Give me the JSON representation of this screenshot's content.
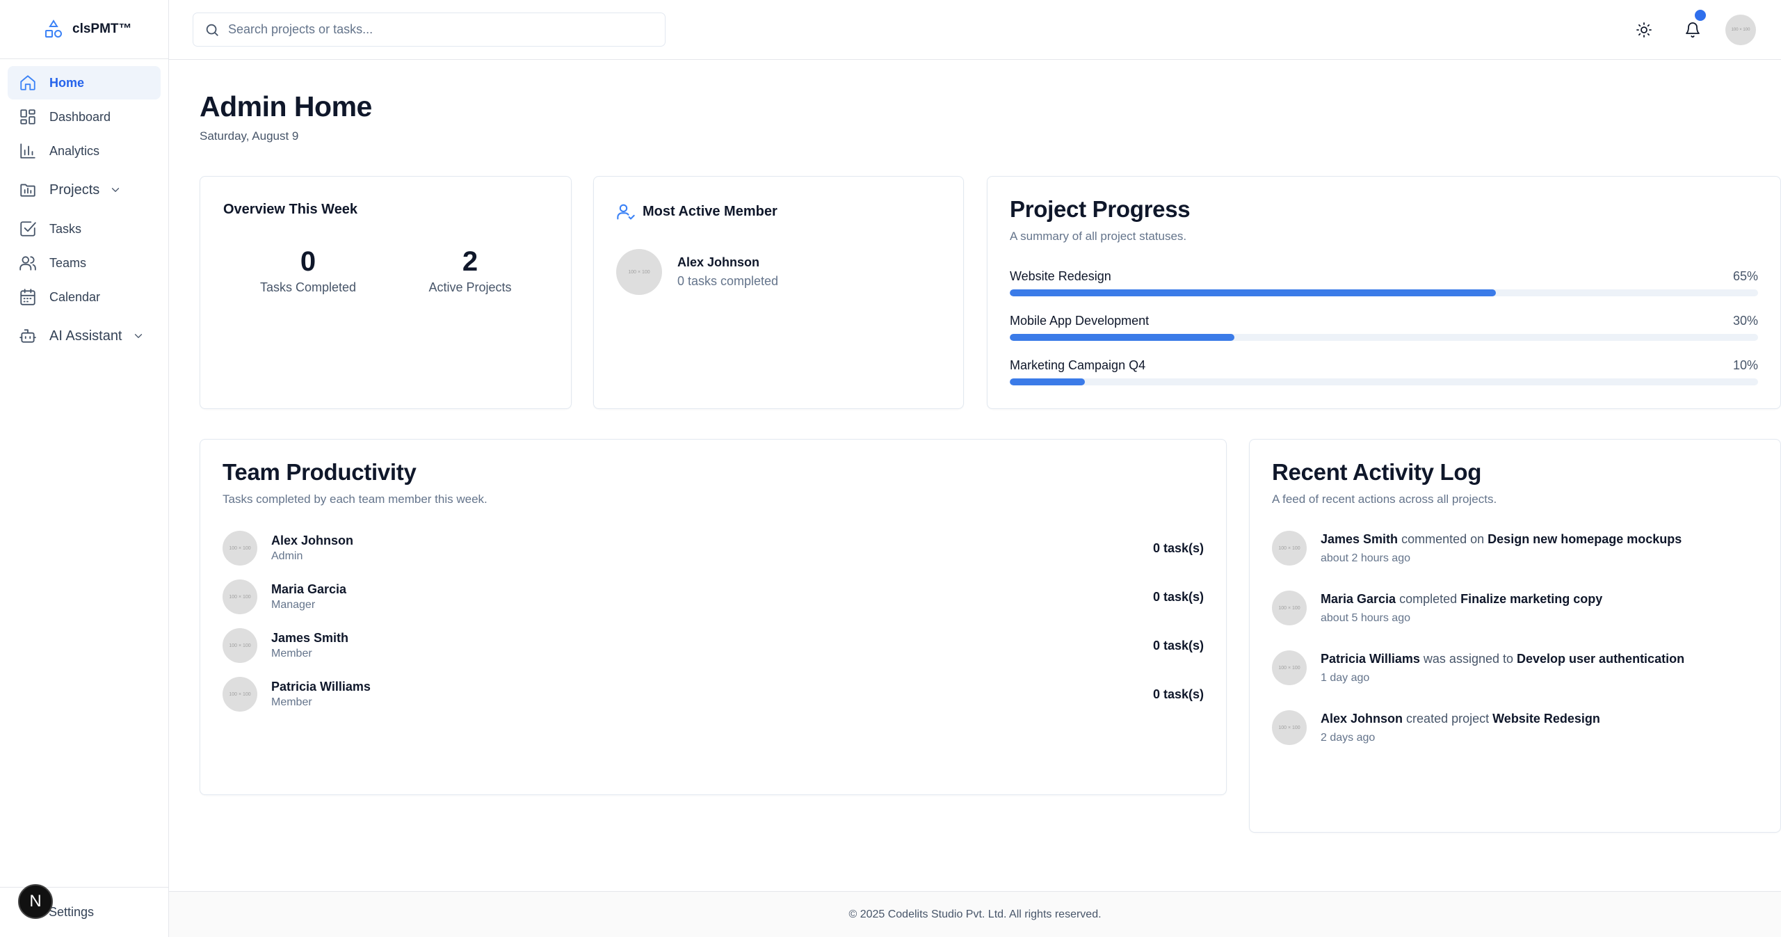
{
  "brand": {
    "name": "clsPMT™"
  },
  "sidebar": {
    "items": [
      {
        "label": "Home"
      },
      {
        "label": "Dashboard"
      },
      {
        "label": "Analytics"
      },
      {
        "label": "Projects"
      },
      {
        "label": "Tasks"
      },
      {
        "label": "Teams"
      },
      {
        "label": "Calendar"
      },
      {
        "label": "AI Assistant"
      }
    ],
    "settings_label": "Settings",
    "n_badge": "N"
  },
  "topbar": {
    "search_placeholder": "Search projects or tasks...",
    "avatar_text": "100 × 100"
  },
  "page": {
    "title": "Admin Home",
    "date": "Saturday, August 9"
  },
  "overview": {
    "title": "Overview This Week",
    "tasks_completed": "0",
    "tasks_completed_label": "Tasks Completed",
    "active_projects": "2",
    "active_projects_label": "Active Projects"
  },
  "most_active": {
    "title": "Most Active Member",
    "name": "Alex Johnson",
    "detail": "0 tasks completed",
    "avatar_text": "100 × 100"
  },
  "project_progress": {
    "title": "Project Progress",
    "subtitle": "A summary of all project statuses.",
    "projects": [
      {
        "name": "Website Redesign",
        "percent_label": "65%",
        "percent": 65
      },
      {
        "name": "Mobile App Development",
        "percent_label": "30%",
        "percent": 30
      },
      {
        "name": "Marketing Campaign Q4",
        "percent_label": "10%",
        "percent": 10
      }
    ]
  },
  "team_productivity": {
    "title": "Team Productivity",
    "subtitle": "Tasks completed by each team member this week.",
    "members": [
      {
        "name": "Alex Johnson",
        "role": "Admin",
        "count": "0 task(s)",
        "avatar_text": "100 × 100"
      },
      {
        "name": "Maria Garcia",
        "role": "Manager",
        "count": "0 task(s)",
        "avatar_text": "100 × 100"
      },
      {
        "name": "James Smith",
        "role": "Member",
        "count": "0 task(s)",
        "avatar_text": "100 × 100"
      },
      {
        "name": "Patricia Williams",
        "role": "Member",
        "count": "0 task(s)",
        "avatar_text": "100 × 100"
      }
    ]
  },
  "activity_log": {
    "title": "Recent Activity Log",
    "subtitle": "A feed of recent actions across all projects.",
    "entries": [
      {
        "actor": "James Smith",
        "action": "commented on",
        "target": "Design new homepage mockups",
        "time": "about 2 hours ago",
        "avatar_text": "100 × 100"
      },
      {
        "actor": "Maria Garcia",
        "action": "completed",
        "target": "Finalize marketing copy",
        "time": "about 5 hours ago",
        "avatar_text": "100 × 100"
      },
      {
        "actor": "Patricia Williams",
        "action": "was assigned to",
        "target": "Develop user authentication",
        "time": "1 day ago",
        "avatar_text": "100 × 100"
      },
      {
        "actor": "Alex Johnson",
        "action": "created project",
        "target": "Website Redesign",
        "time": "2 days ago",
        "avatar_text": "100 × 100"
      }
    ]
  },
  "footer": {
    "text": "© 2025 Codelits Studio Pvt. Ltd. All rights reserved."
  },
  "colors": {
    "accent": "#3b7be8",
    "active_bg": "#eff4fb",
    "notification": "#2f6fec"
  }
}
